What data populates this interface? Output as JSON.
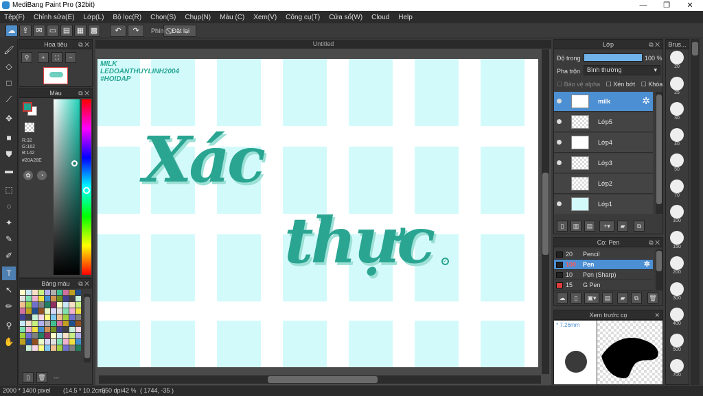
{
  "window": {
    "title": "MediBang Paint Pro (32bit)",
    "minimize": "—",
    "maximize": "❐",
    "close": "✕"
  },
  "menu": [
    "Tệp(F)",
    "Chỉnh sửa(E)",
    "Lớp(L)",
    "Bộ lọc(R)",
    "Chọn(S)",
    "Chụp(N)",
    "Màu (C)",
    "Xem(V)",
    "Công cụ(T)",
    "Cửa sổ(W)",
    "Cloud",
    "Help"
  ],
  "toolbar": {
    "shortcut_label": "Phím",
    "reset_label": "Đặt lại"
  },
  "panels": {
    "navigator": "Hoa tiêu",
    "color": "Màu",
    "palette": "Bảng màu",
    "layers": "Lớp",
    "brush": "Cọ: Pen",
    "brush_preview": "Xem trước cọ",
    "brush_size": "Brus..."
  },
  "color": {
    "r": "R:32",
    "g": "G:162",
    "b": "B:142",
    "hex": "#20A28E",
    "value": "#20a28e"
  },
  "document": {
    "tab": "Untitled",
    "corner_text": [
      "MILK",
      "LEDOANTHUYLINH2004",
      "#HOIDAP"
    ],
    "word1": "Xác",
    "word2": "thực",
    "accent": "#2aa592"
  },
  "layers": {
    "opacity_label": "Độ trong",
    "opacity_value": "100 %",
    "opacity_fraction": 1.0,
    "blend_label": "Pha trộn",
    "blend_value": "Bình thường",
    "protect_alpha": "Bảo vệ alpha",
    "clip": "Xén bớt",
    "lock": "Khóa",
    "items": [
      {
        "name": "milk",
        "selected": true
      },
      {
        "name": "Lớp5"
      },
      {
        "name": "Lớp4"
      },
      {
        "name": "Lớp3"
      },
      {
        "name": "Lớp2"
      },
      {
        "name": "Lớp1"
      }
    ]
  },
  "brushes": [
    {
      "size": "20",
      "name": "Pencil"
    },
    {
      "size": "100",
      "name": "Pen",
      "selected": true
    },
    {
      "size": "10",
      "name": "Pen (Sharp)"
    },
    {
      "size": "15",
      "name": "G Pen"
    }
  ],
  "brush_preview": {
    "size": "7.26mm"
  },
  "brush_sizes": [
    "20",
    "25",
    "30",
    "40",
    "50",
    "70",
    "100",
    "150",
    "200",
    "300",
    "400",
    "500",
    "700"
  ],
  "palette_count": "---",
  "status": {
    "size": "2000 * 1400 pixel",
    "cm": "(14.5 * 10.2cm)",
    "dpi": "350 dpi",
    "zoom": "42 %",
    "coords": "( 1744, -35 )"
  }
}
